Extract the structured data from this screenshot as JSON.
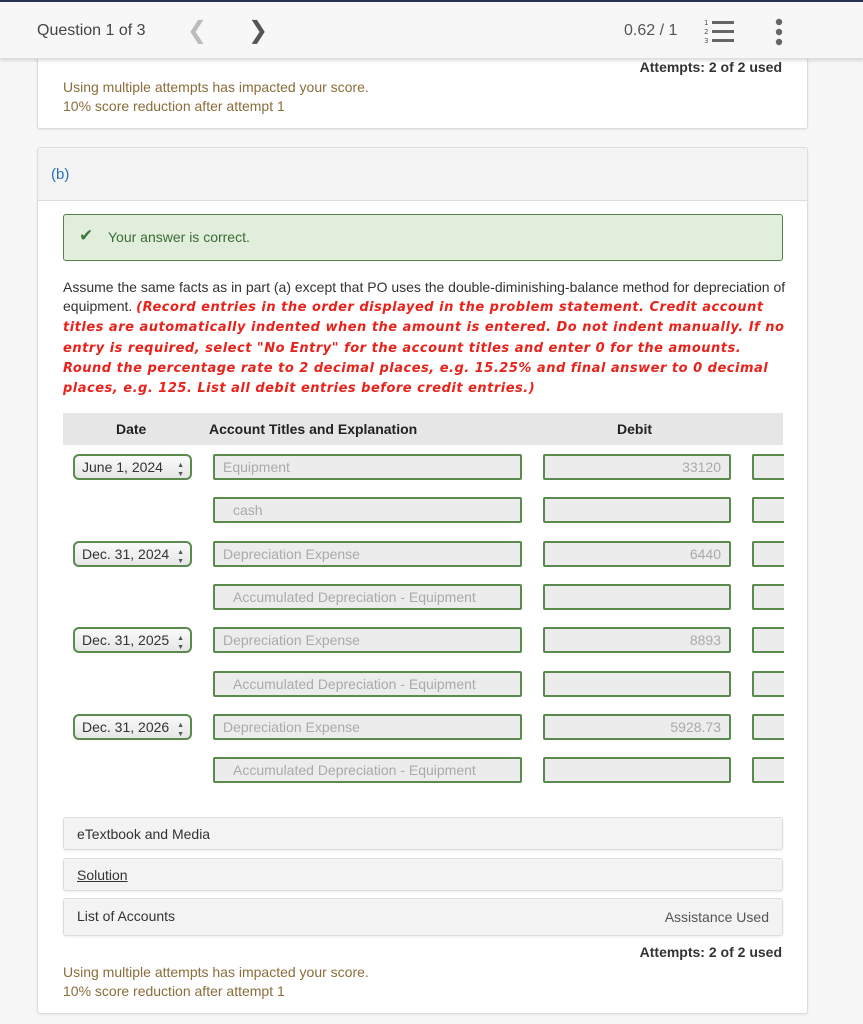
{
  "header": {
    "question_label": "Question 1 of 3",
    "prev_icon": "chevron-left-icon",
    "next_icon": "chevron-right-icon",
    "score": "0.62 / 1",
    "list_icon": "numbered-list-icon",
    "more_icon": "more-vertical-icon"
  },
  "top_card": {
    "attempts": "Attempts: 2 of 2 used",
    "impact_line1": "Using multiple attempts has impacted your score.",
    "impact_line2": "10% score reduction after attempt 1"
  },
  "part_b": {
    "label": "(b)",
    "feedback": {
      "icon": "checkmark-icon",
      "text": "Your answer is correct."
    },
    "instructions": {
      "plain": "Assume the same facts as in part (a) except that PO uses the double-diminishing-balance method for depreciation of equipment. ",
      "emphasis": "(Record entries in the order displayed in the problem statement. Credit account titles are automatically indented when the amount is entered. Do not indent manually. If no entry is required, select \"No Entry\" for the account titles and enter 0 for the amounts. Round the percentage rate to 2 decimal places, e.g. 15.25% and final answer to 0 decimal places, e.g. 125. List all debit entries before credit entries.)"
    },
    "table": {
      "headers": {
        "date": "Date",
        "account": "Account Titles and Explanation",
        "debit": "Debit"
      },
      "rows": [
        {
          "date": "June 1, 2024",
          "account": "Equipment",
          "debit": "33120",
          "credit": ""
        },
        {
          "date": "",
          "account": "cash",
          "debit": "",
          "credit": ""
        },
        {
          "date": "Dec. 31, 2024",
          "account": "Depreciation Expense",
          "debit": "6440",
          "credit": ""
        },
        {
          "date": "",
          "account": "Accumulated Depreciation - Equipment",
          "debit": "",
          "credit": ""
        },
        {
          "date": "Dec. 31, 2025",
          "account": "Depreciation Expense",
          "debit": "8893",
          "credit": ""
        },
        {
          "date": "",
          "account": "Accumulated Depreciation - Equipment",
          "debit": "",
          "credit": ""
        },
        {
          "date": "Dec. 31, 2026",
          "account": "Depreciation Expense",
          "debit": "5928.73",
          "credit": ""
        },
        {
          "date": "",
          "account": "Accumulated Depreciation - Equipment",
          "debit": "",
          "credit": ""
        }
      ]
    },
    "resources": {
      "etextbook": "eTextbook and Media",
      "solution": "Solution",
      "list_of_accounts": "List of Accounts",
      "assistance_used": "Assistance Used"
    },
    "attempts": "Attempts: 2 of 2 used",
    "impact_line1": "Using multiple attempts has impacted your score.",
    "impact_line2": "10% score reduction after attempt 1"
  },
  "colors": {
    "correct_bg": "#e1eedb",
    "correct_border": "#55804a",
    "instruction_red": "#e8231b",
    "impact_text": "#8a6d3b",
    "part_label": "#2a6ebb",
    "field_border": "#5a8a4e"
  }
}
